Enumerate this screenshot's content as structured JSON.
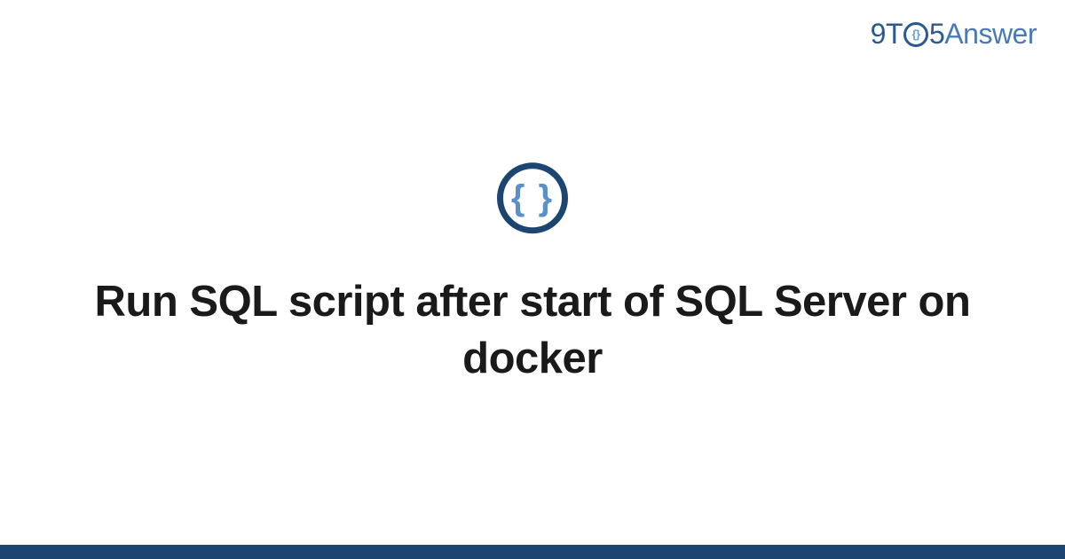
{
  "logo": {
    "part1": "9",
    "part2": "T",
    "clock_inner": "{}",
    "part3": "5",
    "part4": "Answer"
  },
  "main_icon_text": "{ }",
  "title": "Run SQL script after start of SQL Server on docker"
}
